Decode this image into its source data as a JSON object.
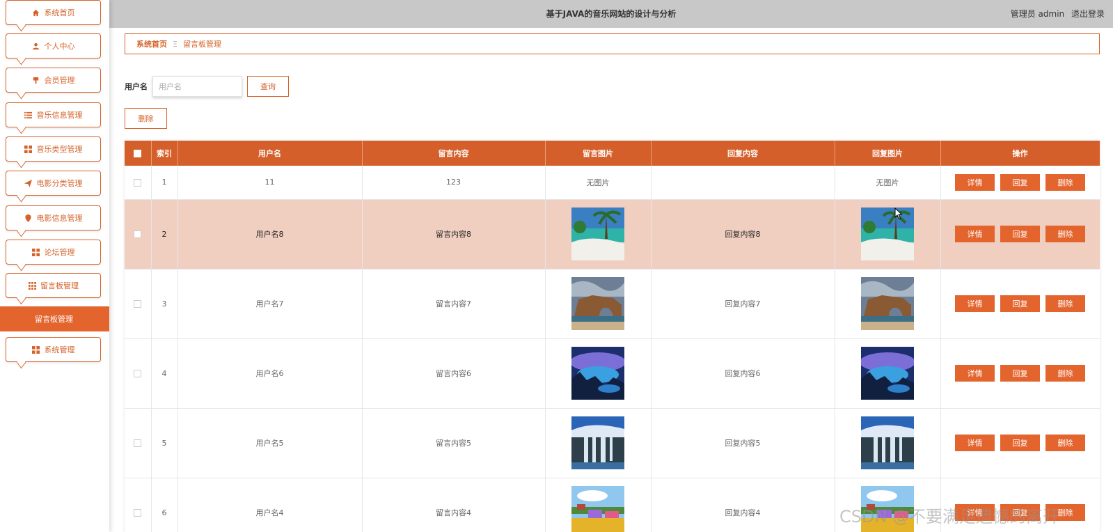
{
  "topbar": {
    "title": "基于JAVA的音乐网站的设计与分析",
    "role": "管理员 admin",
    "logout": "退出登录"
  },
  "sidebar": {
    "items": [
      {
        "label": "系统首页",
        "icon": "home-icon"
      },
      {
        "label": "个人中心",
        "icon": "user-icon"
      },
      {
        "label": "会员管理",
        "icon": "member-icon"
      },
      {
        "label": "音乐信息管理",
        "icon": "list-icon"
      },
      {
        "label": "音乐类型管理",
        "icon": "grid-icon"
      },
      {
        "label": "电影分类管理",
        "icon": "send-icon"
      },
      {
        "label": "电影信息管理",
        "icon": "pin-icon"
      },
      {
        "label": "论坛管理",
        "icon": "grid-icon"
      },
      {
        "label": "留言板管理",
        "icon": "apps-icon"
      },
      {
        "label": "系统管理",
        "icon": "grid-icon"
      }
    ],
    "active_sub": "留言板管理"
  },
  "breadcrumb": {
    "home": "系统首页",
    "separator": "Ξ",
    "current": "留言板管理"
  },
  "search": {
    "label": "用户名",
    "placeholder": "用户名",
    "value": "",
    "query_button": "查询",
    "delete_button": "删除"
  },
  "table": {
    "headers": [
      "",
      "索引",
      "用户名",
      "留言内容",
      "留言图片",
      "回复内容",
      "回复图片",
      "操作"
    ],
    "ops": [
      "详情",
      "回复",
      "删除"
    ],
    "rows": [
      {
        "index": "1",
        "username": "11",
        "content": "123",
        "image": "无图片",
        "reply": "",
        "reply_image": "无图片"
      },
      {
        "index": "2",
        "username": "用户名8",
        "content": "留言内容8",
        "image": "beach",
        "reply": "回复内容8",
        "reply_image": "beach"
      },
      {
        "index": "3",
        "username": "用户名7",
        "content": "留言内容7",
        "image": "arch",
        "reply": "回复内容7",
        "reply_image": "arch"
      },
      {
        "index": "4",
        "username": "用户名6",
        "content": "留言内容6",
        "image": "fantasy",
        "reply": "回复内容6",
        "reply_image": "fantasy"
      },
      {
        "index": "5",
        "username": "用户名5",
        "content": "留言内容5",
        "image": "waterfall",
        "reply": "回复内容5",
        "reply_image": "waterfall"
      },
      {
        "index": "6",
        "username": "用户名4",
        "content": "留言内容4",
        "image": "flowers",
        "reply": "回复内容4",
        "reply_image": "flowers"
      }
    ]
  },
  "watermark": "CSDN @不要满足遗憾的离开",
  "colors": {
    "accent": "#d4622a",
    "header_bg": "#d45f2a",
    "highlight_row": "#f0cfc0",
    "topbar": "#c8c8c8"
  }
}
